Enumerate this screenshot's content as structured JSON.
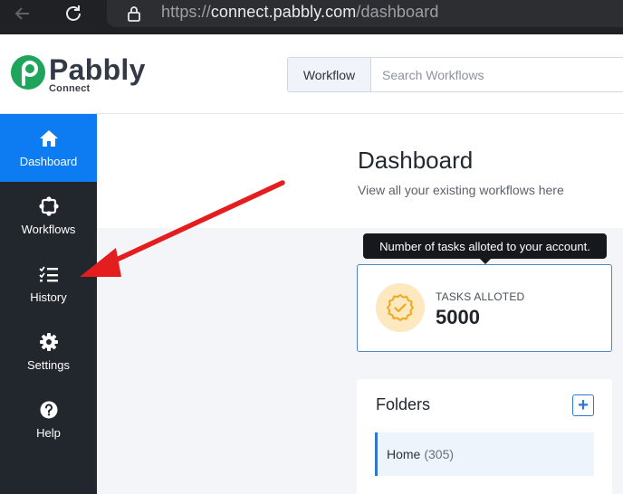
{
  "browser": {
    "url_scheme": "https://",
    "url_host": "connect.pabbly.com",
    "url_path": "/dashboard"
  },
  "header": {
    "logo_text": "Pabbly",
    "logo_sub": "Connect",
    "search_type": "Workflow",
    "search_placeholder": "Search Workflows"
  },
  "sidebar": {
    "items": [
      {
        "label": "Dashboard",
        "icon": "home-icon",
        "active": true
      },
      {
        "label": "Workflows",
        "icon": "workflow-icon",
        "active": false
      },
      {
        "label": "History",
        "icon": "checklist-icon",
        "active": false
      },
      {
        "label": "Settings",
        "icon": "gear-icon",
        "active": false
      },
      {
        "label": "Help",
        "icon": "help-icon",
        "active": false
      }
    ]
  },
  "main": {
    "title": "Dashboard",
    "subtitle": "View all your existing workflows here",
    "tooltip": "Number of tasks alloted to your account.",
    "tasks": {
      "label": "TASKS ALLOTED",
      "value": "5000",
      "icon": "verified-badge-icon"
    },
    "folders": {
      "title": "Folders",
      "add_label": "+",
      "items": [
        {
          "name": "Home",
          "count": "(305)"
        }
      ]
    }
  },
  "colors": {
    "brand_green": "#1fa45b",
    "accent_blue": "#0d7cf2",
    "sidebar_bg": "#22262d",
    "arrow_red": "#e41e1e"
  }
}
